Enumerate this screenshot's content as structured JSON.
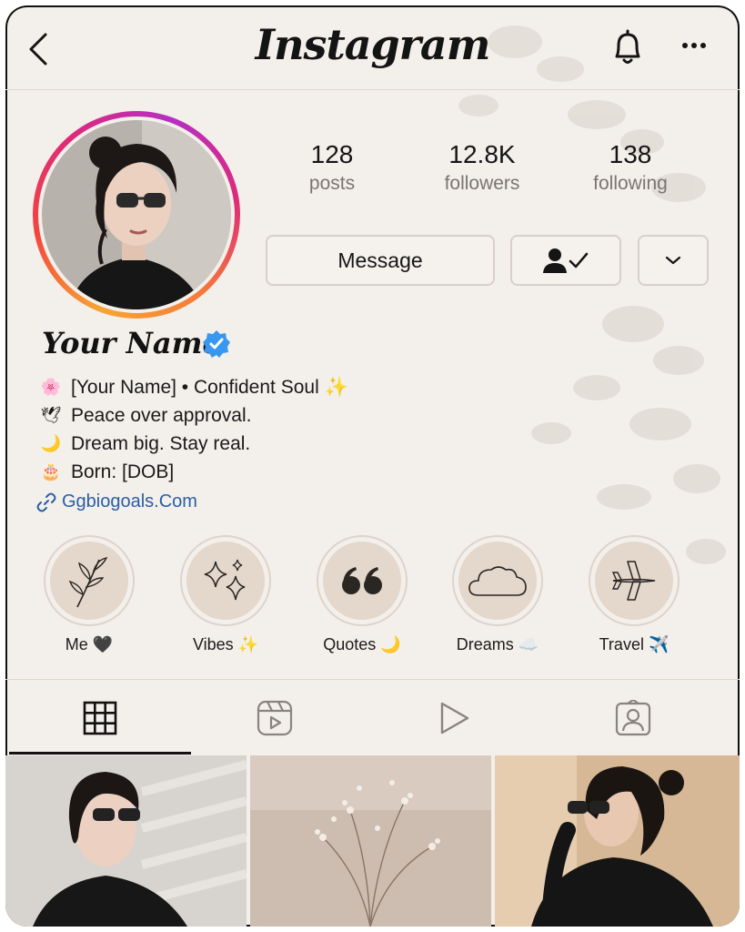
{
  "header": {
    "logo": "Instagram"
  },
  "profile": {
    "stats": [
      {
        "value": "128",
        "label": "posts"
      },
      {
        "value": "12.8K",
        "label": "followers"
      },
      {
        "value": "138",
        "label": "following"
      }
    ],
    "message_label": "Message",
    "name": "Your Name",
    "bio": [
      {
        "emoji": "🌸",
        "text": "[Your Name] • Confident Soul ✨"
      },
      {
        "emoji": "🕊",
        "text": "Peace over approval."
      },
      {
        "emoji": "🌙",
        "text": "Dream big. Stay real."
      },
      {
        "emoji": "🎂",
        "text": "Born: [DOB]"
      }
    ],
    "link": "Ggbiogoals.Com"
  },
  "highlights": [
    {
      "label": "Me 🖤",
      "icon": "leaf-icon"
    },
    {
      "label": "Vibes ✨",
      "icon": "sparkles-icon"
    },
    {
      "label": "Quotes 🌙",
      "icon": "quote-icon"
    },
    {
      "label": "Dreams ☁️",
      "icon": "cloud-icon"
    },
    {
      "label": "Travel ✈️",
      "icon": "airplane-icon"
    }
  ],
  "tabs": [
    "grid-icon",
    "reels-icon",
    "video-icon",
    "tagged-icon"
  ],
  "colors": {
    "background": "#f3efea",
    "highlight_fill": "#e4d7cb",
    "link": "#2b5ea8",
    "verified": "#3897f0"
  }
}
